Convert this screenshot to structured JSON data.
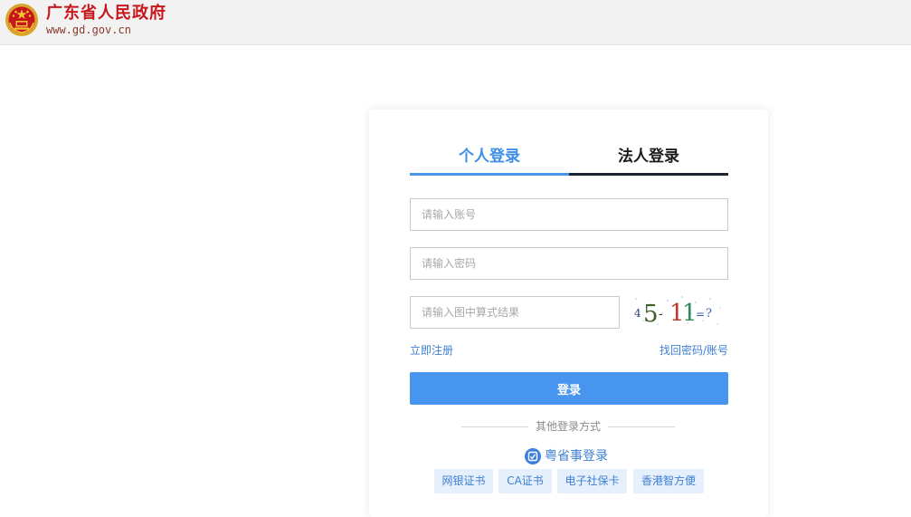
{
  "header": {
    "site_title": "广东省人民政府",
    "site_url": "www.gd.gov.cn",
    "emblem_icon": "national-emblem-icon",
    "title_color": "#c8161d"
  },
  "login": {
    "tabs": [
      {
        "label": "个人登录",
        "active": true
      },
      {
        "label": "法人登录",
        "active": false
      }
    ],
    "account_placeholder": "请输入账号",
    "password_placeholder": "请输入密码",
    "captcha_placeholder": "请输入图中算式结果",
    "captcha_text": [
      "4",
      "5",
      "-",
      "1",
      "1",
      "=",
      "?"
    ],
    "register_link": "立即注册",
    "forgot_link": "找回密码/账号",
    "login_button": "登录",
    "other_methods_label": "其他登录方式",
    "yss_login": "粤省事登录",
    "yss_icon": "yueshengshi-icon",
    "methods": [
      "网银证书",
      "CA证书",
      "电子社保卡",
      "香港智方便"
    ],
    "accent_color": "#4895ef"
  }
}
